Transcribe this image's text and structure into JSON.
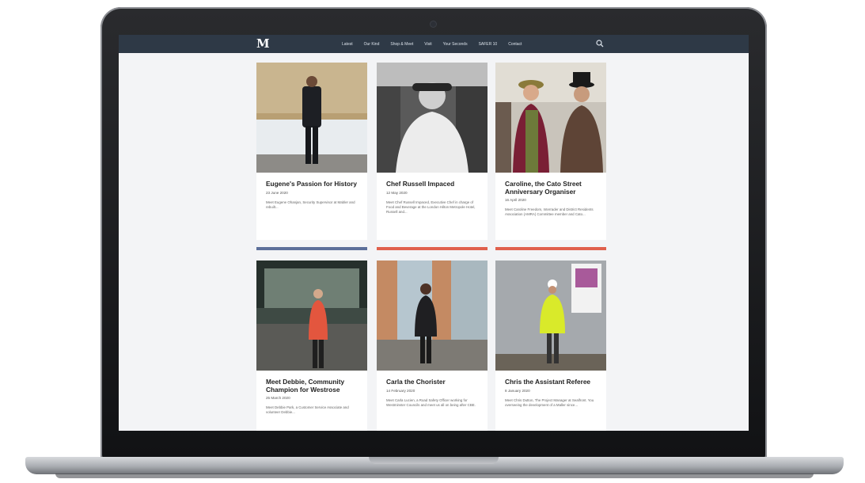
{
  "site": {
    "logo": "M",
    "nav": [
      "Latest",
      "Our Kind",
      "Shop & Meet",
      "Visit",
      "Your Seconds",
      "SAFER 10",
      "Contact"
    ]
  },
  "colors": {
    "nav_bg": "#2e3946",
    "accent_blue": "#5c6f9a",
    "accent_red": "#e0604c"
  },
  "cards": [
    {
      "title": "Eugene's Passion for History",
      "date": "23 June 2020",
      "excerpt": "Meet Eugene Ohanjan, Security Supervisor at Mabler and rebuilt..."
    },
    {
      "title": "Chef Russell Impaced",
      "date": "12 May 2020",
      "excerpt": "Meet Chef Russell Impaced, Executive Chef in charge of Food and Beverage at the London Hilton Metropole Hotel, Russell and..."
    },
    {
      "title": "Caroline, the Cato Street Anniversary Organiser",
      "date": "16 April 2020",
      "excerpt": "Meet Caroline Freedom, Interrader and District Residents Association (AMRA) Committee member and Cato..."
    },
    {
      "title": "Meet Debbie, Community Champion for Westrose",
      "date": "25 March 2020",
      "excerpt": "Meet Debbie Park, a Customer Service Associate and volunteer Debbie..."
    },
    {
      "title": "Carla the Chorister",
      "date": "14 February 2020",
      "excerpt": "Meet Carla Lucien, a Road Safety Officer working for Westminster Councils and meet us all on being after CBE."
    },
    {
      "title": "Chris the Assistant Referee",
      "date": "8 January 2020",
      "excerpt": "Meet Chris Dutton, The Project Manager at Sealfront. You overseeing the development of a Maller since..."
    }
  ]
}
